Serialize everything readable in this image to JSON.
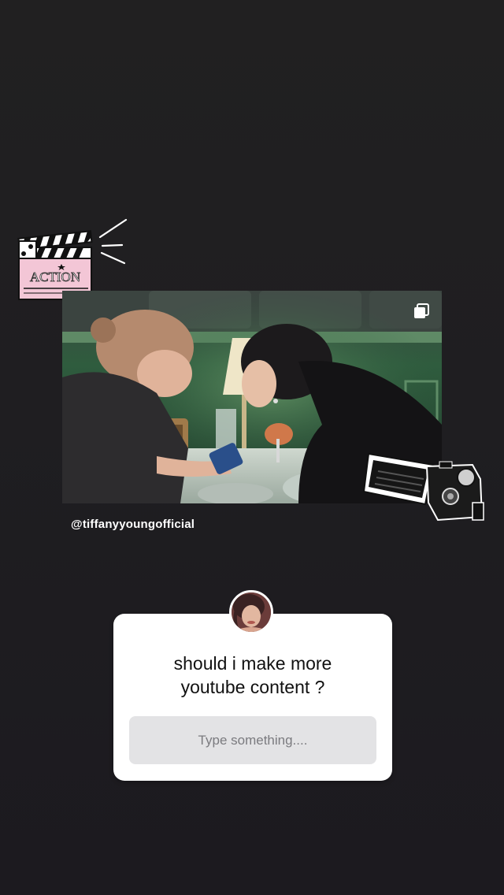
{
  "story": {
    "background_color": "#1f1e21"
  },
  "clapper_sticker": {
    "text": "ACTION"
  },
  "post": {
    "author_handle": "@tiffanyyoungofficial",
    "multi_image_icon": "carousel-icon"
  },
  "camcorder_sticker": {
    "icon": "camcorder-icon"
  },
  "question_sticker": {
    "question": "should i make more\nyoutube content ?",
    "placeholder": "Type something....",
    "avatar_icon": "profile-avatar"
  }
}
